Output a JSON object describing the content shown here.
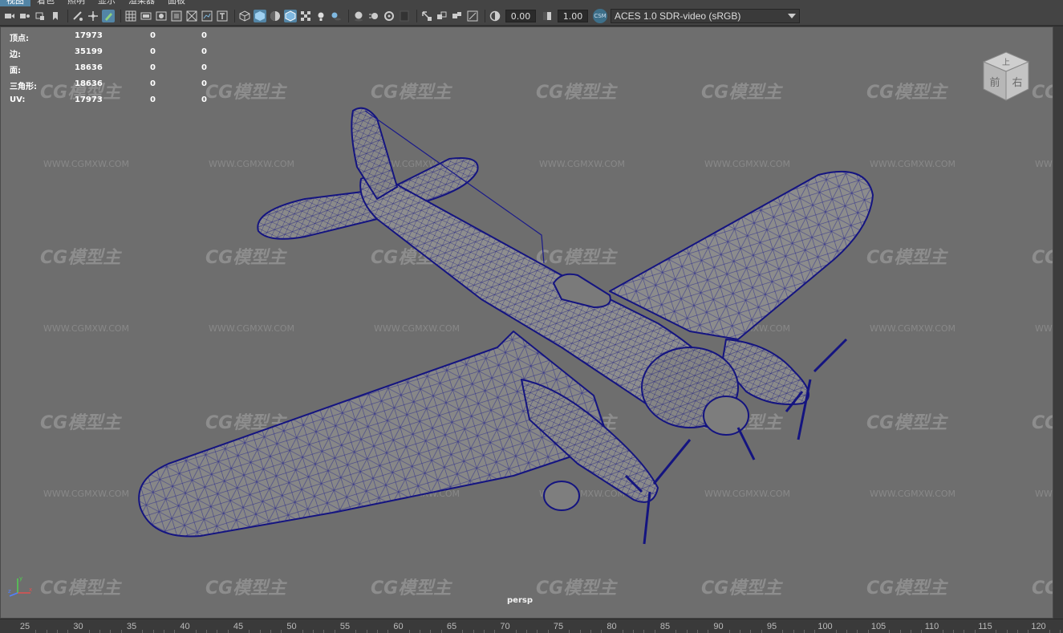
{
  "menu": [
    {
      "label": "视图",
      "active": true
    },
    {
      "label": "着色",
      "active": false
    },
    {
      "label": "照明",
      "active": false
    },
    {
      "label": "显示",
      "active": false
    },
    {
      "label": "渲染器",
      "active": false
    },
    {
      "label": "面板",
      "active": false
    }
  ],
  "toolbar": {
    "icons": [
      "camera-icon",
      "camera-attributes-icon",
      "bookmark-icon",
      "image-plane-icon",
      "grease-pencil-icon",
      "grid-icon",
      "film-gate-icon",
      "resolution-gate-icon",
      "gate-mask-icon",
      "field-chart-icon",
      "safe-action-icon",
      "safe-title-icon",
      "wireframe-icon",
      "smooth-shade-icon",
      "default-material-icon",
      "wireframe-on-shaded-icon",
      "xray-icon",
      "lights-icon",
      "shadows-icon",
      "ambient-occlusion-icon",
      "motion-blur-icon",
      "anti-aliasing-icon",
      "depth-of-field-icon",
      "isolate-select-icon",
      "xray-joints-icon",
      "xray-active-icon",
      "exposure-icon"
    ],
    "exposure": "0.00",
    "gamma": "1.00",
    "csm_badge": "CSM",
    "color_space": "ACES 1.0 SDR-video (sRGB)"
  },
  "hud": {
    "rows": [
      {
        "label": "顶点:",
        "v1": "17973",
        "v2": "0",
        "v3": "0"
      },
      {
        "label": "边:",
        "v1": "35199",
        "v2": "0",
        "v3": "0"
      },
      {
        "label": "面:",
        "v1": "18636",
        "v2": "0",
        "v3": "0"
      },
      {
        "label": "三角形:",
        "v1": "18636",
        "v2": "0",
        "v3": "0"
      },
      {
        "label": "UV:",
        "v1": "17973",
        "v2": "0",
        "v3": "0"
      }
    ]
  },
  "viewcube": {
    "top": "上",
    "front": "前",
    "right": "右"
  },
  "watermark": {
    "logo": "CG模型主",
    "url": "WWW.CGMXW.COM"
  },
  "camera_label": "persp",
  "axis": {
    "x": "x",
    "y": "y",
    "z": "z"
  },
  "timeline": {
    "ticks": [
      "25",
      "30",
      "35",
      "40",
      "45",
      "50",
      "55",
      "60",
      "65",
      "70",
      "75",
      "80",
      "85",
      "90",
      "95",
      "100",
      "105",
      "110",
      "115",
      "120"
    ]
  },
  "colors": {
    "viewport_bg": "#6e6e6e",
    "wireframe": "#1a1a8c",
    "accent": "#5285a6"
  }
}
